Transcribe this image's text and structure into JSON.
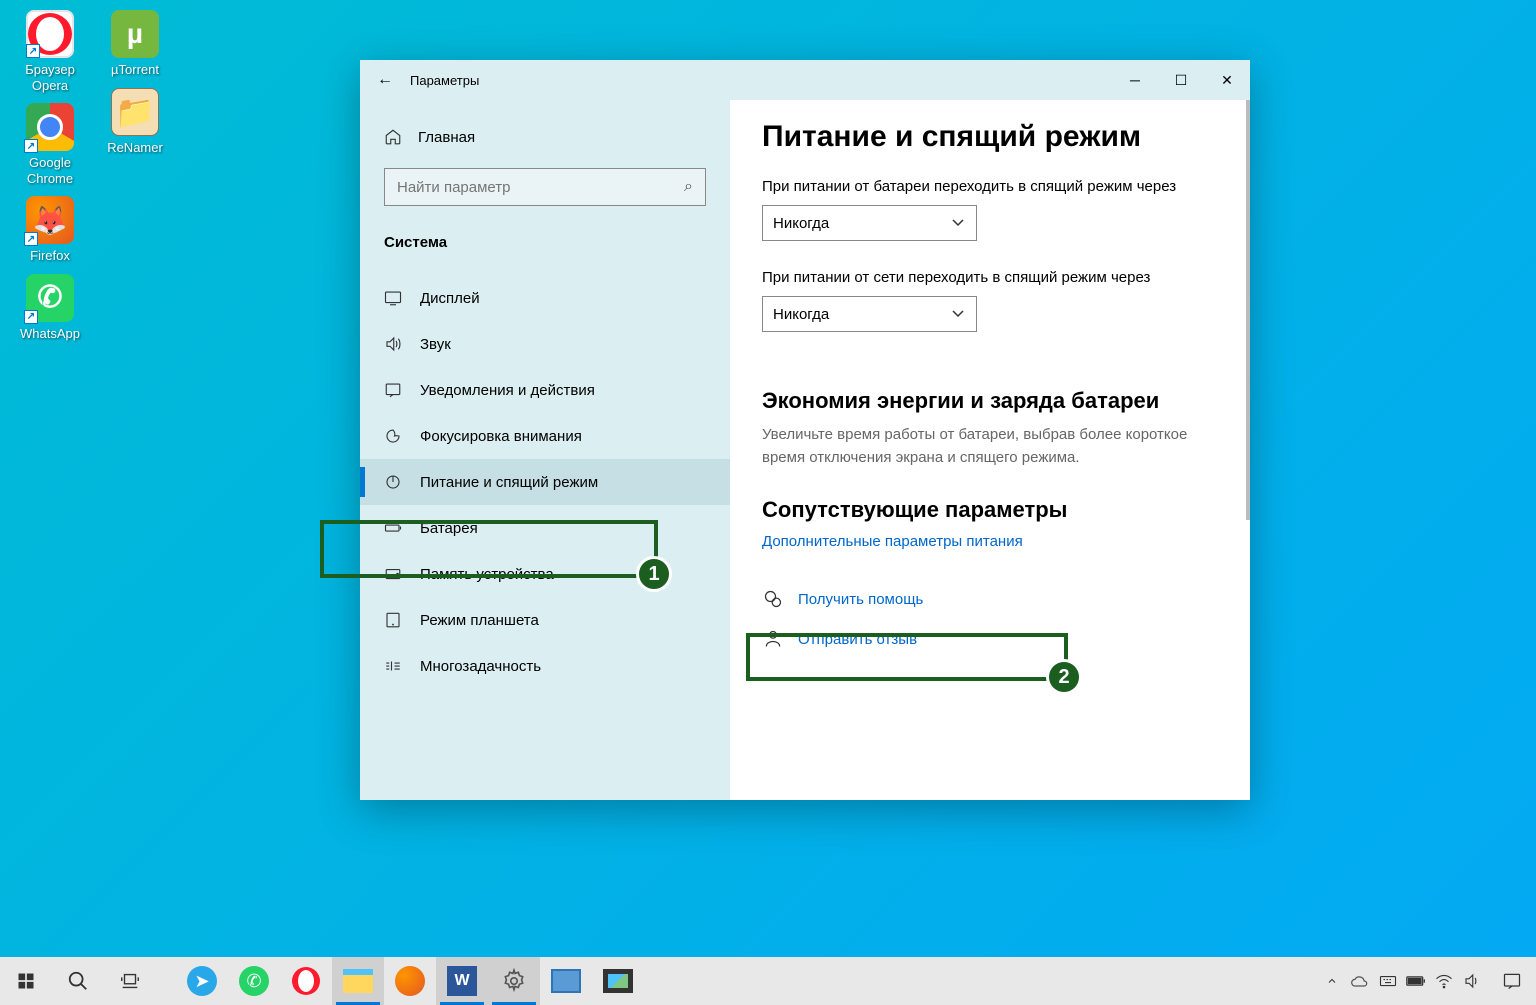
{
  "desktop": {
    "icons_col1": [
      {
        "name": "opera",
        "label": "Браузер\nOpera"
      },
      {
        "name": "chrome",
        "label": "Google\nChrome"
      },
      {
        "name": "firefox",
        "label": "Firefox"
      },
      {
        "name": "whatsapp",
        "label": "WhatsApp"
      }
    ],
    "icons_col2": [
      {
        "name": "utorrent",
        "label": "µTorrent"
      },
      {
        "name": "renamer",
        "label": "ReNamer"
      }
    ]
  },
  "window": {
    "title": "Параметры",
    "home": "Главная",
    "search_placeholder": "Найти параметр",
    "section": "Система",
    "nav": [
      {
        "id": "display",
        "label": "Дисплей"
      },
      {
        "id": "sound",
        "label": "Звук"
      },
      {
        "id": "notifications",
        "label": "Уведомления и действия"
      },
      {
        "id": "focus",
        "label": "Фокусировка внимания"
      },
      {
        "id": "power",
        "label": "Питание и спящий режим",
        "active": true
      },
      {
        "id": "battery",
        "label": "Батарея"
      },
      {
        "id": "storage",
        "label": "Память устройства"
      },
      {
        "id": "tablet",
        "label": "Режим планшета"
      },
      {
        "id": "multitask",
        "label": "Многозадачность"
      }
    ]
  },
  "content": {
    "heading": "Питание и спящий режим",
    "battery_sleep_label": "При питании от батареи переходить в спящий режим через",
    "battery_sleep_value": "Никогда",
    "plugged_sleep_label": "При питании от сети переходить в спящий режим через",
    "plugged_sleep_value": "Никогда",
    "saver_heading": "Экономия энергии и заряда батареи",
    "saver_desc": "Увеличьте время работы от батареи, выбрав более короткое время отключения экрана и спящего режима.",
    "related_heading": "Сопутствующие параметры",
    "related_link": "Дополнительные параметры питания",
    "help_link": "Получить помощь",
    "feedback_link": "Отправить отзыв"
  },
  "annotations": {
    "one": "1",
    "two": "2"
  }
}
